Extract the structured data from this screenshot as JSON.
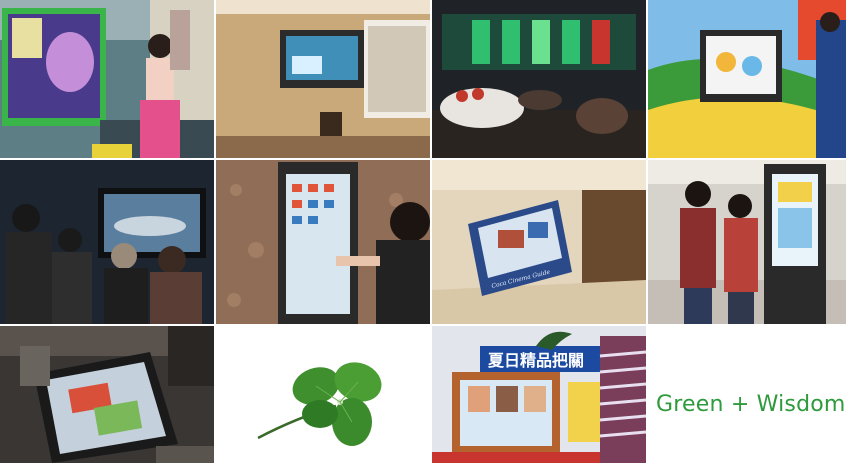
{
  "slogan": "Green + Wisdom",
  "signs": {
    "poster_heading": "夏日精品把關",
    "kiosk_caption": "Coca Cinema Guide"
  },
  "colors": {
    "slogan_green": "#2f9a3c",
    "leaf_green": "#3f8f2f",
    "lounge_accent": "#c0392b"
  }
}
